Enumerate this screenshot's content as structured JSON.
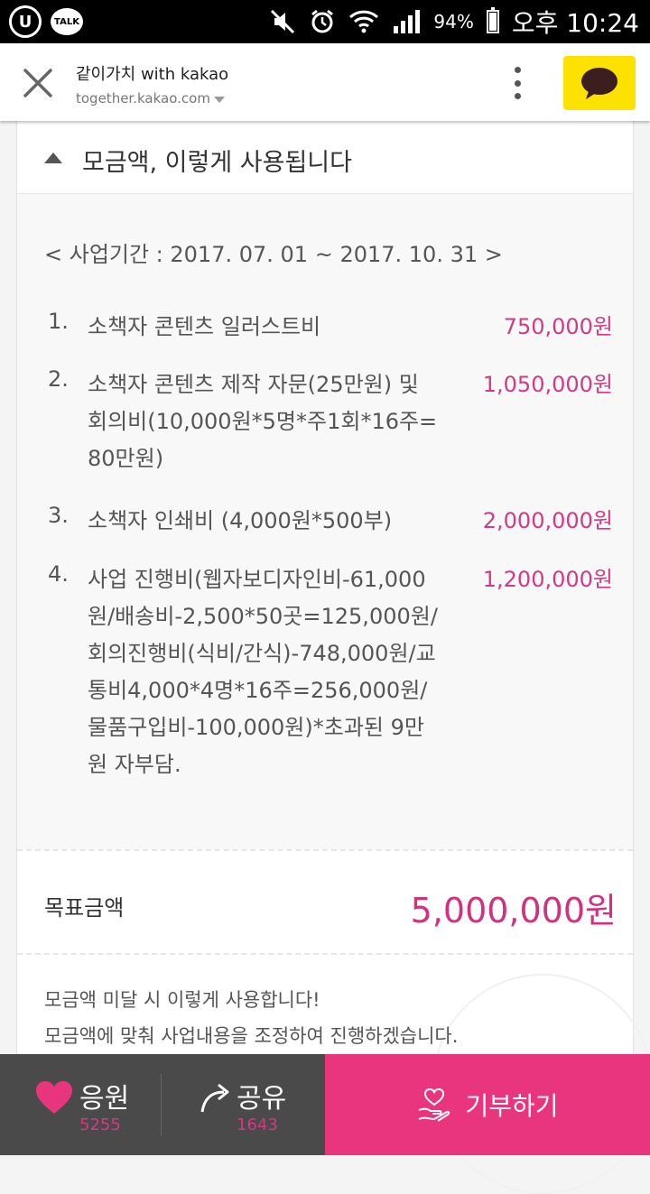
{
  "status_bar": {
    "left_badge": "U",
    "talk_badge": "TALK",
    "battery_percent": "94%",
    "time": "오후 10:24"
  },
  "header": {
    "title": "같이가치 with kakao",
    "url": "together.kakao.com",
    "icons": {
      "close": "close-icon",
      "more": "more-vert-icon",
      "chat": "kakaotalk-icon"
    },
    "chat_button_color": "#fde200"
  },
  "section": {
    "title": "모금액, 이렇게 사용됩니다",
    "period": "< 사업기간 : 2017. 07. 01 ~ 2017. 10. 31 >",
    "items": [
      {
        "num": "1.",
        "desc": "소책자 콘텐츠 일러스트비",
        "amount": "750,000원"
      },
      {
        "num": "2.",
        "desc": "소책자 콘텐츠 제작 자문(25만원) 및 회의비(10,000원*5명*주1회*16주=80만원)",
        "amount": "1,050,000원"
      },
      {
        "num": "3.",
        "desc": "소책자 인쇄비 (4,000원*500부)",
        "amount": "2,000,000원"
      },
      {
        "num": "4.",
        "desc": "사업 진행비(웹자보디자인비-61,000원/배송비-2,500*50곳=125,000원/회의진행비(식비/간식)-748,000원/교통비4,000*4명*16주=256,000원/물품구입비-100,000원)*초과된 9만원 자부담.",
        "amount": "1,200,000원"
      }
    ],
    "goal_label": "목표금액",
    "goal_value": "5,000,000원",
    "note_line1": "모금액 미달 시 이렇게 사용합니다!",
    "note_line2": "모금액에 맞춰 사업내용을 조정하여 진행하겠습니다.",
    "accent_color": "#d23a83"
  },
  "bottom_bar": {
    "cheer_label": "응원",
    "cheer_count": "5255",
    "share_label": "공유",
    "share_count": "1643",
    "donate_label": "기부하기",
    "donate_color": "#e8357d"
  }
}
